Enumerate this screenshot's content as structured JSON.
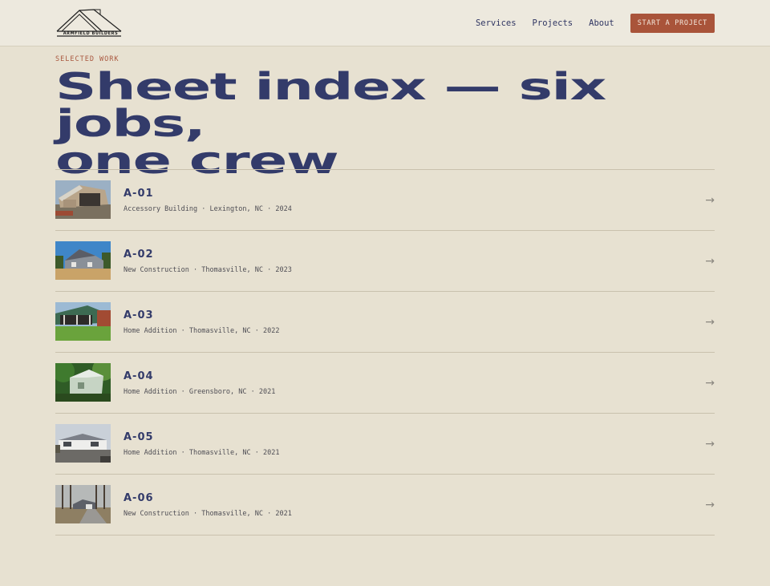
{
  "brand": {
    "name": "ARMFIELD BUILDERS",
    "logo_icon": "house-roof-logo-icon"
  },
  "nav": {
    "links": [
      "Services",
      "Projects",
      "About"
    ],
    "cta_label": "START A PROJECT",
    "cta_color": "#a9543a"
  },
  "hero": {
    "eyebrow": "SELECTED WORK",
    "title_line1": "Sheet index — six jobs,",
    "title_line2": "one crew"
  },
  "sheets": [
    {
      "code": "A-01",
      "meta": "Accessory Building · Lexington, NC · 2024",
      "thumb": "garage-construction-photo",
      "arrow": "→"
    },
    {
      "code": "A-02",
      "meta": "New Construction · Thomasville, NC · 2023",
      "thumb": "new-house-photo",
      "arrow": "→"
    },
    {
      "code": "A-03",
      "meta": "Home Addition · Thomasville, NC · 2022",
      "thumb": "porch-addition-photo",
      "arrow": "→"
    },
    {
      "code": "A-04",
      "meta": "Home Addition · Greensboro, NC · 2021",
      "thumb": "green-addition-photo",
      "arrow": "→"
    },
    {
      "code": "A-05",
      "meta": "Home Addition · Thomasville, NC · 2021",
      "thumb": "ranch-house-photo",
      "arrow": "→"
    },
    {
      "code": "A-06",
      "meta": "New Construction · Thomasville, NC · 2021",
      "thumb": "wooded-lot-house-photo",
      "arrow": "→"
    }
  ]
}
